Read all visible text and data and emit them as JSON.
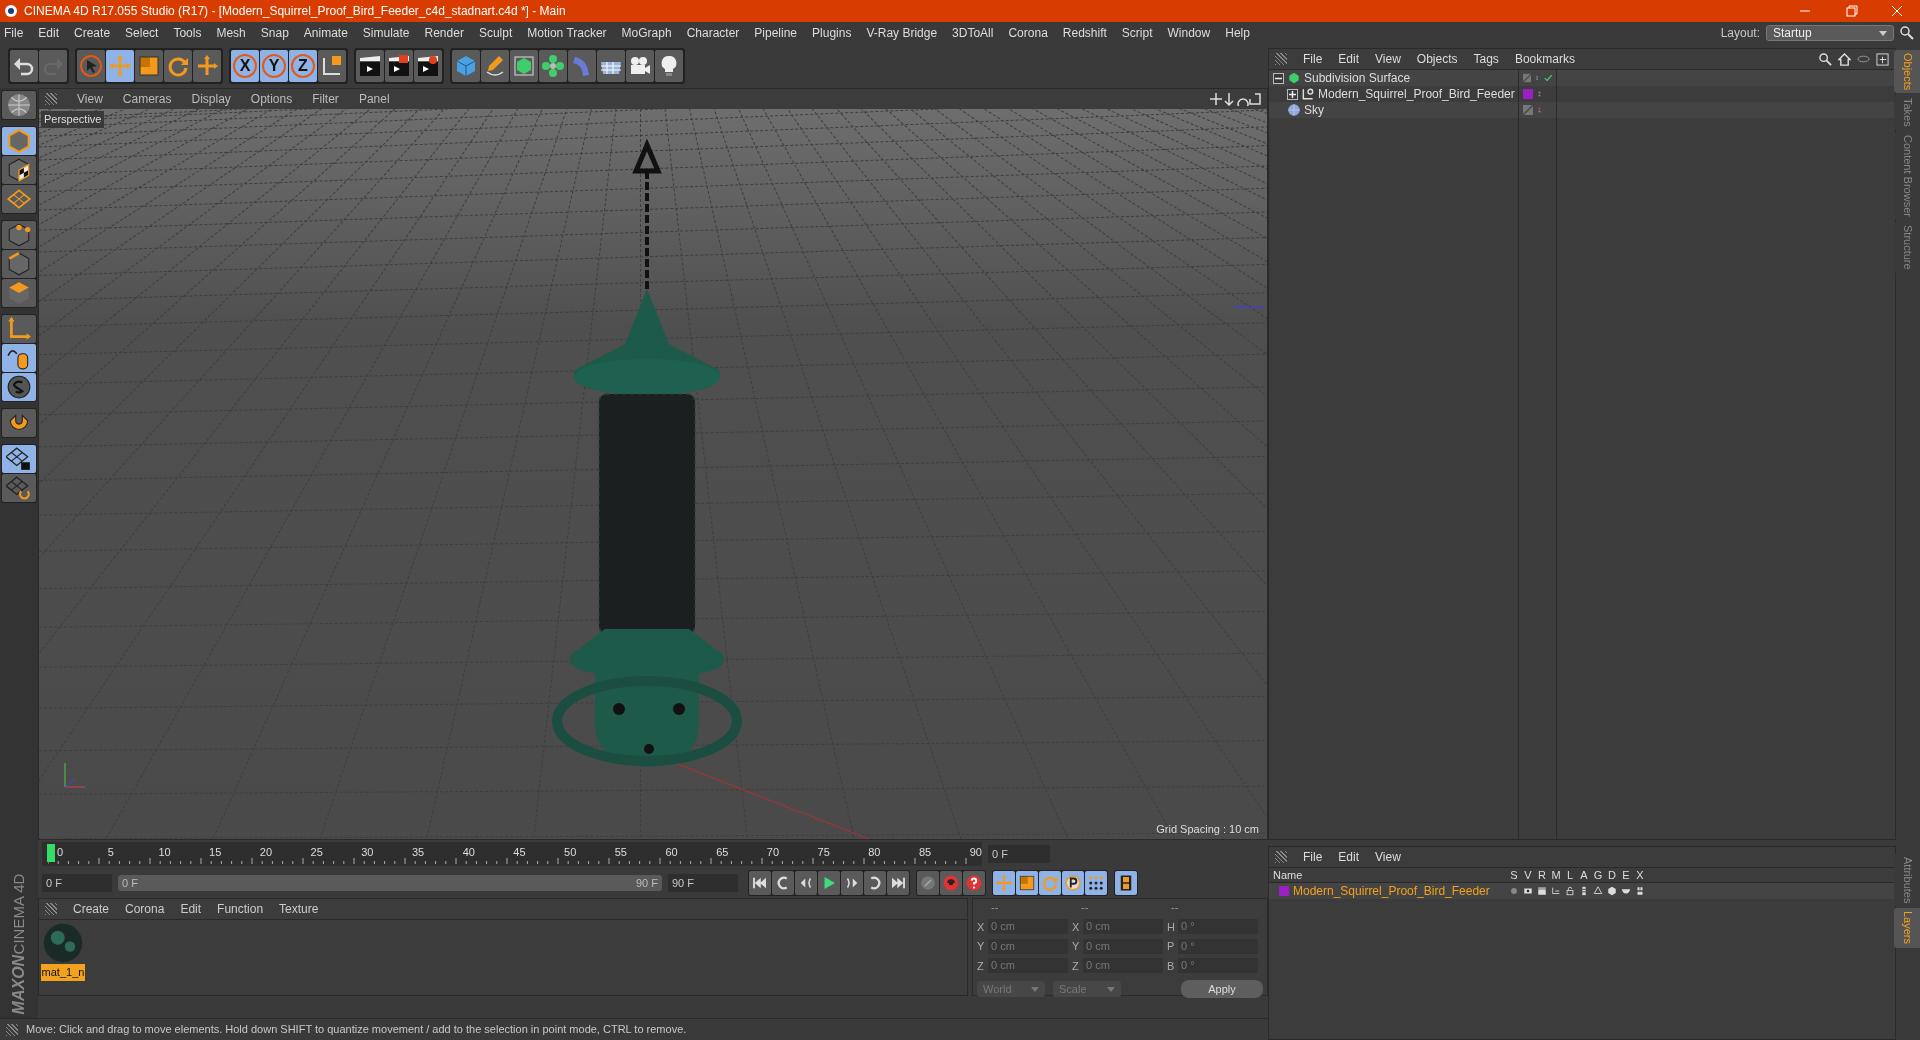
{
  "window": {
    "title": "CINEMA 4D R17.055 Studio (R17) - [Modern_Squirrel_Proof_Bird_Feeder_c4d_stadnart.c4d *] - Main"
  },
  "menu_bar": [
    "File",
    "Edit",
    "Create",
    "Select",
    "Tools",
    "Mesh",
    "Snap",
    "Animate",
    "Simulate",
    "Render",
    "Sculpt",
    "Motion Tracker",
    "MoGraph",
    "Character",
    "Pipeline",
    "Plugins",
    "V-Ray Bridge",
    "3DToAll",
    "Corona",
    "Redshift",
    "Script",
    "Window",
    "Help"
  ],
  "layout": {
    "label": "Layout:",
    "value": "Startup"
  },
  "toolbar": [
    [
      {
        "kind": "undo",
        "active": false,
        "disabled": false
      },
      {
        "kind": "redo",
        "active": false,
        "disabled": true
      }
    ],
    [
      {
        "kind": "select",
        "active": false,
        "disabled": false
      },
      {
        "kind": "move",
        "active": true,
        "disabled": false
      },
      {
        "kind": "scale",
        "active": false,
        "disabled": false
      },
      {
        "kind": "rotate",
        "active": false,
        "disabled": false
      },
      {
        "kind": "transform",
        "active": false,
        "disabled": false
      }
    ],
    [
      {
        "kind": "axis",
        "label": "X",
        "active": true,
        "disabled": false
      },
      {
        "kind": "axis",
        "label": "Y",
        "active": true,
        "disabled": false
      },
      {
        "kind": "axis",
        "label": "Z",
        "active": true,
        "disabled": false
      },
      {
        "kind": "coords",
        "active": false,
        "disabled": false
      }
    ],
    [
      {
        "kind": "render_view",
        "active": false,
        "disabled": false
      },
      {
        "kind": "render_picture",
        "active": false,
        "disabled": false
      },
      {
        "kind": "render_settings",
        "active": false,
        "disabled": false
      }
    ],
    [
      {
        "kind": "cube",
        "active": false,
        "disabled": false
      },
      {
        "kind": "pen",
        "active": false,
        "disabled": false
      },
      {
        "kind": "subdivision",
        "active": false,
        "disabled": false
      },
      {
        "kind": "cloner",
        "active": false,
        "disabled": false
      },
      {
        "kind": "deformer",
        "active": false,
        "disabled": false
      },
      {
        "kind": "floor",
        "active": false,
        "disabled": false
      },
      {
        "kind": "camera",
        "active": false,
        "disabled": false
      },
      {
        "kind": "light",
        "active": false,
        "disabled": false
      }
    ]
  ],
  "left_toolbar": [
    [
      {
        "kind": "make_editable",
        "active": false
      }
    ],
    [
      {
        "kind": "model",
        "active": true
      },
      {
        "kind": "texture",
        "active": false
      },
      {
        "kind": "workplane",
        "active": false
      }
    ],
    [
      {
        "kind": "points",
        "active": false
      },
      {
        "kind": "edges",
        "active": false
      },
      {
        "kind": "polygons",
        "active": false
      }
    ],
    [
      {
        "kind": "axis_mode",
        "active": false
      },
      {
        "kind": "tweak",
        "active": true
      },
      {
        "kind": "solo",
        "active": true
      }
    ],
    [
      {
        "kind": "snap",
        "active": false
      }
    ],
    [
      {
        "kind": "workplane_lock",
        "active": true
      },
      {
        "kind": "workplane_sync",
        "active": false
      }
    ]
  ],
  "logo": {
    "brand": "MAXON",
    "product": "CINEMA 4D"
  },
  "viewport": {
    "menu": [
      "View",
      "Cameras",
      "Display",
      "Options",
      "Filter",
      "Panel"
    ],
    "camera": "Perspective",
    "grid_spacing": "Grid Spacing : 10 cm"
  },
  "timeline": {
    "ticks": [
      "0",
      "5",
      "10",
      "15",
      "20",
      "25",
      "30",
      "35",
      "40",
      "45",
      "50",
      "55",
      "60",
      "65",
      "70",
      "75",
      "80",
      "85",
      "90"
    ],
    "level": 0,
    "current_frame": "0 F",
    "start": "0 F",
    "range_start": "0 F",
    "range_end": "90 F",
    "end": "90 F",
    "buttons": [
      [
        {
          "kind": "first",
          "active": false
        },
        {
          "kind": "prev_key",
          "active": false
        },
        {
          "kind": "prev_frame",
          "active": false
        },
        {
          "kind": "play",
          "active": false
        },
        {
          "kind": "next_frame",
          "active": false
        },
        {
          "kind": "next_key",
          "active": false
        },
        {
          "kind": "last",
          "active": false
        }
      ],
      [
        {
          "kind": "keyframe",
          "active": false
        },
        {
          "kind": "autokey",
          "active": false
        },
        {
          "kind": "key_help",
          "active": false
        }
      ],
      [
        {
          "kind": "move",
          "active": true
        },
        {
          "kind": "scale",
          "active": true
        },
        {
          "kind": "rotate",
          "active": true
        },
        {
          "kind": "param",
          "active": true
        },
        {
          "kind": "pla",
          "active": true
        }
      ],
      [
        {
          "kind": "film",
          "active": true
        }
      ]
    ]
  },
  "materials": {
    "menu": [
      "Create",
      "Corona",
      "Edit",
      "Function",
      "Texture"
    ],
    "items": [
      {
        "name": "mat_1_n",
        "selected": true
      }
    ]
  },
  "coordinates": {
    "headers": [
      "--",
      "--",
      "--"
    ],
    "rows": [
      {
        "pos_label": "X",
        "pos": "0 cm",
        "size_label": "X",
        "size": "0 cm",
        "rot_label": "H",
        "rot": "0 °"
      },
      {
        "pos_label": "Y",
        "pos": "0 cm",
        "size_label": "Y",
        "size": "0 cm",
        "rot_label": "P",
        "rot": "0 °"
      },
      {
        "pos_label": "Z",
        "pos": "0 cm",
        "size_label": "Z",
        "size": "0 cm",
        "rot_label": "B",
        "rot": "0 °"
      }
    ],
    "mode": "World",
    "transform": "Scale",
    "apply": "Apply"
  },
  "objects": {
    "menu": [
      "File",
      "Edit",
      "View",
      "Objects",
      "Tags",
      "Bookmarks"
    ],
    "tree": [
      {
        "name": "Subdivision Surface",
        "kind": "subdivision",
        "expanded": true,
        "enabled": true,
        "hidden": false,
        "children": [
          {
            "name": "Modern_Squirrel_Proof_Bird_Feeder",
            "kind": "null",
            "expanded": false,
            "hidden": false,
            "color": "#9b1fc6"
          }
        ]
      },
      {
        "name": "Sky",
        "kind": "sky",
        "hidden": true
      }
    ]
  },
  "side_tabs_top": [
    {
      "label": "Objects",
      "selected": true
    },
    {
      "label": "Takes",
      "selected": false
    },
    {
      "label": "Content Browser",
      "selected": false
    },
    {
      "label": "Structure",
      "selected": false
    }
  ],
  "layers": {
    "menu": [
      "File",
      "Edit",
      "View"
    ],
    "columns": [
      "Name",
      "S",
      "V",
      "R",
      "M",
      "L",
      "A",
      "G",
      "D",
      "E",
      "X"
    ],
    "rows": [
      {
        "name": "Modern_Squirrel_Proof_Bird_Feeder",
        "color": "#9b1fc6"
      }
    ]
  },
  "side_tabs_bottom": [
    {
      "label": "Attributes",
      "selected": false
    },
    {
      "label": "Layers",
      "selected": true
    }
  ],
  "status_bar": "Move: Click and drag to move elements. Hold down SHIFT to quantize movement / add to the selection in point mode, CTRL to remove."
}
